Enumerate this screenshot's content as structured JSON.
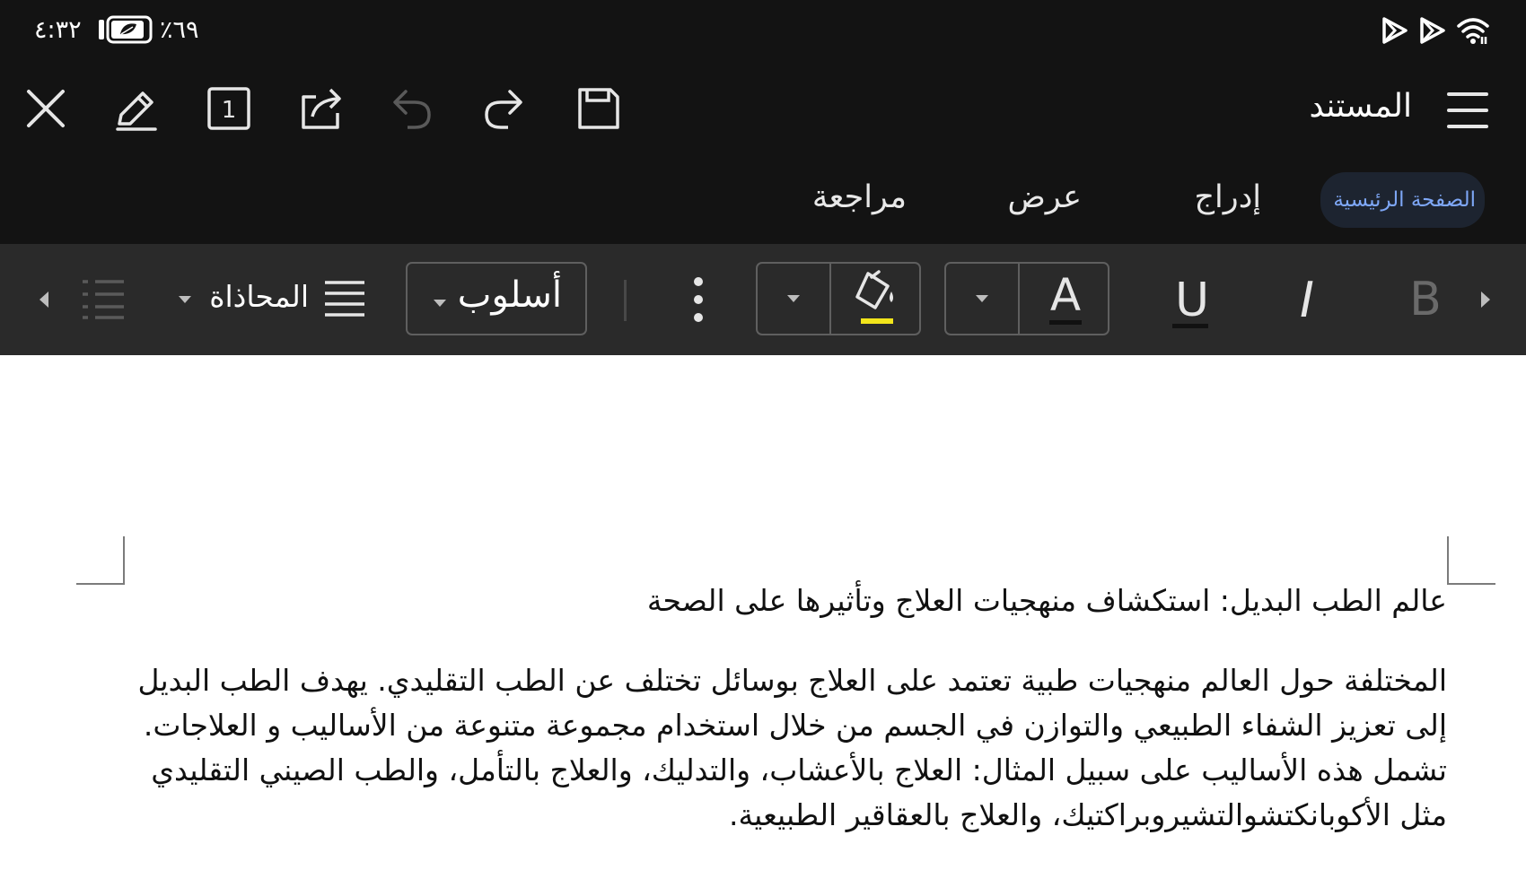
{
  "status_bar": {
    "time": "٤:٣٢",
    "battery_percent": "٪٦٩",
    "icons": [
      "battery-leaf-icon",
      "play-icon",
      "play-icon",
      "wifi-icon"
    ]
  },
  "top_bar": {
    "title": "المستند",
    "page_number": "1",
    "icons": [
      "close-icon",
      "pen-icon",
      "page-count-icon",
      "share-icon",
      "undo-icon",
      "redo-icon",
      "save-icon",
      "hamburger-icon"
    ]
  },
  "tabs": [
    {
      "label": "الصفحة الرئيسية",
      "active": true
    },
    {
      "label": "إدراج",
      "active": false
    },
    {
      "label": "عرض",
      "active": false
    },
    {
      "label": "مراجعة",
      "active": false
    }
  ],
  "ribbon": {
    "bold_glyph": "B",
    "italic_glyph": "I",
    "underline_glyph": "U",
    "font_color_glyph": "A",
    "style_label": "أسلوب",
    "alignment_label": "المحاذاة",
    "highlight_color": "#f2e51b",
    "font_color": "#111111"
  },
  "document": {
    "heading": "عالم الطب البديل: استكشاف منهجيات العلاج وتأثيرها على الصحة",
    "paragraph": "المختلفة حول العالم منهجيات طبية تعتمد على العلاج بوسائل تختلف عن الطب التقليدي. يهدف الطب البديل إلى تعزيز الشفاء الطبيعي والتوازن في الجسم من خلال استخدام مجموعة متنوعة من الأساليب و العلاجات. تشمل هذه الأساليب على سبيل المثال: العلاج بالأعشاب، والتدليك، والعلاج بالتأمل، والطب الصيني التقليدي مثل الأكوبانكتشوالتشيروبراكتيك، والعلاج بالعقاقير الطبيعية."
  },
  "colors": {
    "chrome": "#131313",
    "ribbon": "#2a2a2a",
    "accent": "#7ea7f6",
    "disabled": "#5a5a5a"
  }
}
